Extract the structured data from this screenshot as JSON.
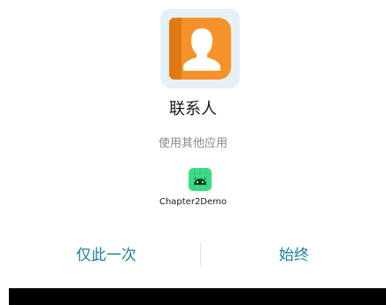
{
  "dialog": {
    "app_name": "联系人",
    "subtitle": "使用其他应用",
    "handler": {
      "icon": "android-icon",
      "label": "Chapter2Demo",
      "icon_color": "#3ddc84"
    },
    "app_icon": {
      "icon": "contacts-person-icon",
      "color": "#f5932a"
    }
  },
  "actions": {
    "just_once": "仅此一次",
    "always": "始终",
    "accent_color": "#1a7fa0"
  }
}
